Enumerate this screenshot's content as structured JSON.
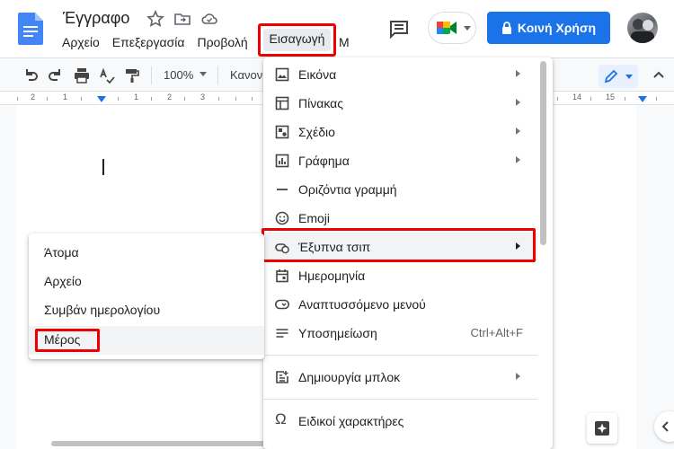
{
  "header": {
    "doc_title": "Έγγραφο",
    "menus": [
      "Αρχείο",
      "Επεξεργασία",
      "Προβολή"
    ],
    "active_menu": "Εισαγωγή",
    "more_menu_partial": "Μ",
    "share_label": "Κοινή Χρήση"
  },
  "toolbar": {
    "zoom": "100%",
    "style": "Κανονι"
  },
  "ruler": {
    "numbers": [
      "2",
      "1",
      "1",
      "2",
      "3",
      "14",
      "15"
    ]
  },
  "insert_menu": {
    "items": [
      {
        "label": "Εικόνα",
        "icon": "image-icon",
        "has_submenu": true
      },
      {
        "label": "Πίνακας",
        "icon": "table-icon",
        "has_submenu": true
      },
      {
        "label": "Σχέδιο",
        "icon": "drawing-icon",
        "has_submenu": true
      },
      {
        "label": "Γράφημα",
        "icon": "chart-icon",
        "has_submenu": true
      },
      {
        "label": "Οριζόντια γραμμή",
        "icon": "horizontal-line-icon",
        "has_submenu": false
      },
      {
        "label": "Emoji",
        "icon": "emoji-icon",
        "has_submenu": false
      },
      {
        "label": "Έξυπνα τσιπ",
        "icon": "smart-chip-icon",
        "has_submenu": true
      },
      {
        "label": "Ημερομηνία",
        "icon": "calendar-icon",
        "has_submenu": false
      },
      {
        "label": "Αναπτυσσόμενο μενού",
        "icon": "dropdown-icon",
        "has_submenu": false
      },
      {
        "label": "Υποσημείωση",
        "icon": "footnote-icon",
        "has_submenu": false,
        "shortcut": "Ctrl+Alt+F"
      },
      {
        "label": "Δημιουργία μπλοκ",
        "icon": "building-block-icon",
        "has_submenu": true
      },
      {
        "label": "Ειδικοί χαρακτήρες",
        "icon": "omega-icon",
        "has_submenu": false
      }
    ]
  },
  "chips_submenu": {
    "items": [
      "Άτομα",
      "Αρχείο",
      "Συμβάν ημερολογίου",
      "Μέρος"
    ]
  },
  "colors": {
    "accent": "#1a73e8",
    "highlight": "#e00000"
  }
}
